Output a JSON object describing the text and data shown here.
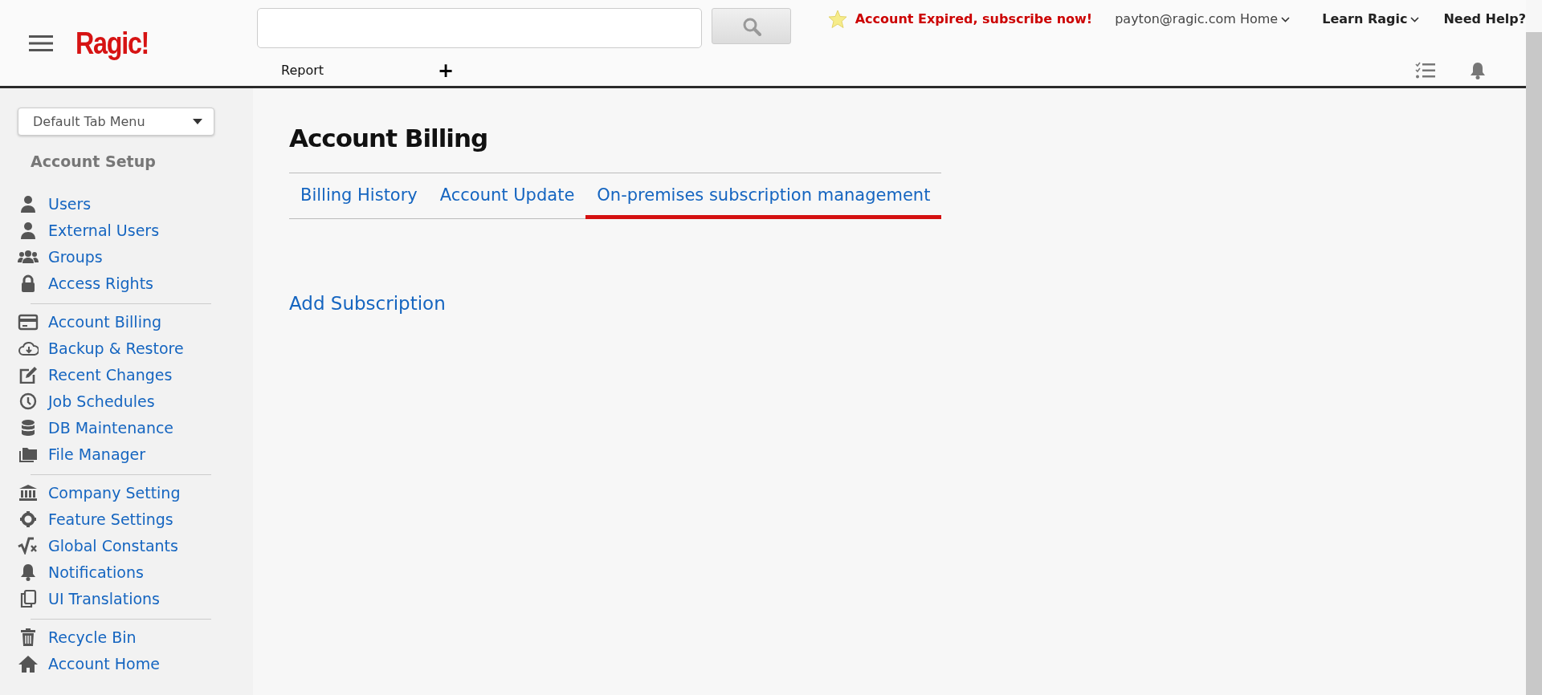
{
  "header": {
    "logo": "Ragic!",
    "alert": "Account Expired, subscribe now!",
    "account_menu": "payton@ragic.com Home",
    "learn_menu": "Learn Ragic",
    "help": "Need Help?",
    "tabs": [
      {
        "label": "Report",
        "selected": false
      }
    ],
    "add_tab": "+"
  },
  "sidebar": {
    "tab_menu": "Default Tab Menu",
    "section_title": "Account Setup",
    "groups": [
      [
        {
          "label": "Users",
          "selected": false
        },
        {
          "label": "External Users",
          "selected": false
        },
        {
          "label": "Groups",
          "selected": false
        },
        {
          "label": "Access Rights",
          "selected": false
        }
      ],
      [
        {
          "label": "Account Billing",
          "selected": false
        },
        {
          "label": "Backup & Restore",
          "selected": false
        },
        {
          "label": "Recent Changes",
          "selected": false
        },
        {
          "label": "Job Schedules",
          "selected": false
        },
        {
          "label": "DB Maintenance",
          "selected": false
        },
        {
          "label": "File Manager",
          "selected": false
        }
      ],
      [
        {
          "label": "Company Setting",
          "selected": false
        },
        {
          "label": "Feature Settings",
          "selected": false
        },
        {
          "label": "Global Constants",
          "selected": false
        },
        {
          "label": "Notifications",
          "selected": false
        },
        {
          "label": "UI Translations",
          "selected": false
        }
      ],
      [
        {
          "label": "Recycle Bin",
          "selected": false
        },
        {
          "label": "Account Home",
          "selected": false
        }
      ]
    ]
  },
  "main": {
    "title": "Account Billing",
    "tabs": [
      {
        "label": "Billing History",
        "selected": false
      },
      {
        "label": "Account Update",
        "selected": false
      },
      {
        "label": "On-premises subscription management",
        "selected": true
      }
    ],
    "link": "Add Subscription"
  }
}
